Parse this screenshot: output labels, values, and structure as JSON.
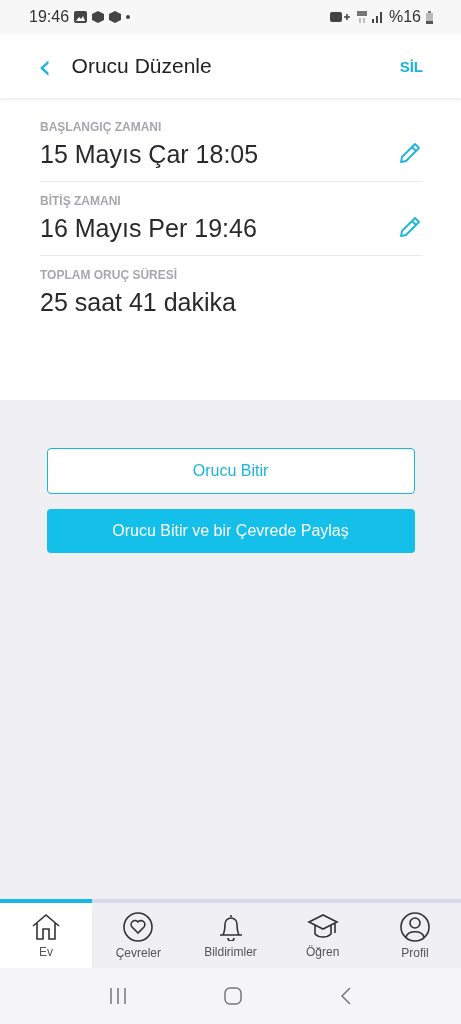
{
  "status_bar": {
    "time": "19:46",
    "battery": "%16"
  },
  "header": {
    "back": "‹",
    "title": "Orucu Düzenle",
    "action": "SİL"
  },
  "fields": [
    {
      "label": "BAŞLANGIÇ ZAMANI",
      "value": "15 Mayıs Çar 18:05",
      "kind": "editable"
    },
    {
      "label": "BİTİŞ ZAMANI",
      "value": "16 Mayıs Per 19:46",
      "kind": "editable"
    },
    {
      "label": "TOPLAM ORUÇ SÜRESİ",
      "value": "25 saat 41 dakika",
      "kind": "total"
    }
  ],
  "buttons": [
    {
      "label": "Orucu Bitir",
      "kind": "outline"
    },
    {
      "label": "Orucu Bitir ve bir Çevrede Paylaş",
      "kind": "filled"
    }
  ],
  "tabs": [
    {
      "label": "Ev",
      "selected": true
    },
    {
      "label": "Çevreler",
      "selected": false
    },
    {
      "label": "Bildirimler",
      "selected": false
    },
    {
      "label": "Öğren",
      "selected": false
    },
    {
      "label": "Profil",
      "selected": false
    }
  ]
}
